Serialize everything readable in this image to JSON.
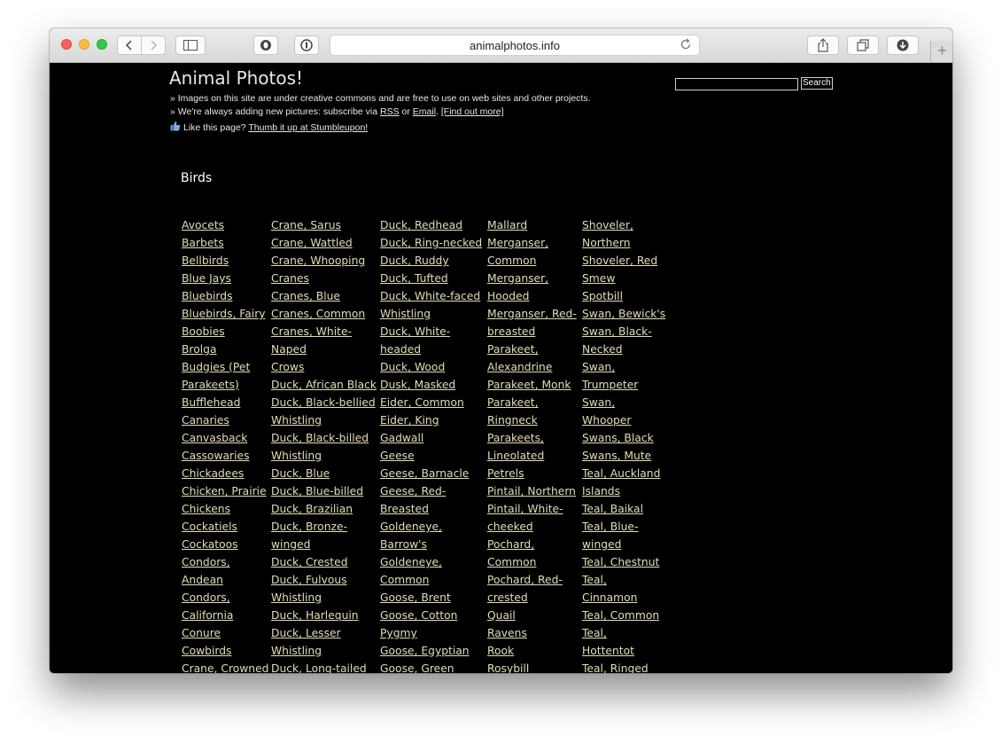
{
  "browser": {
    "url": "animalphotos.info",
    "new_tab_symbol": "+"
  },
  "site": {
    "title": "Animal Photos!",
    "line1": "» Images on this site are under creative commons and are free to use on web sites and other projects.",
    "line2_prefix": "» We're always adding new pictures: subscribe via ",
    "rss_link": "RSS",
    "line2_or": " or ",
    "email_link": "Email",
    "line2_dot": ". ",
    "find_out_more": "[Find out more]",
    "line3_text": "Like this page? ",
    "stumble_link": "Thumb it up at Stumbleupon!",
    "search_value": "",
    "search_button": "Search"
  },
  "section": {
    "heading": "Birds"
  },
  "columns": [
    [
      "Avocets",
      "Barbets",
      "Bellbirds",
      "Blue Jays",
      "Bluebirds",
      "Bluebirds, Fairy",
      "Boobies",
      "Brolga",
      "Budgies (Pet",
      "Parakeets)",
      "Bufflehead",
      "Canaries",
      "Canvasback",
      "Cassowaries",
      "Chickadees",
      "Chicken, Prairie",
      "Chickens",
      "Cockatiels",
      "Cockatoos",
      "Condors,",
      "Andean",
      "Condors,",
      "California",
      "Conure",
      "Cowbirds",
      "Crane, Crowned"
    ],
    [
      "Crane, Sarus",
      "Crane, Wattled",
      "Crane, Whooping",
      "Cranes",
      "Cranes, Blue",
      "Cranes, Common",
      "Cranes, White-",
      "Naped",
      "Crows",
      "Duck, African Black",
      "Duck, Black-bellied",
      "Whistling",
      "Duck, Black-billed",
      "Whistling",
      "Duck, Blue",
      "Duck, Blue-billed",
      "Duck, Brazilian",
      "Duck, Bronze-",
      "winged",
      "Duck, Crested",
      "Duck, Fulvous",
      "Whistling",
      "Duck, Harlequin",
      "Duck, Lesser",
      "Whistling",
      "Duck, Long-tailed"
    ],
    [
      "Duck, Redhead",
      "Duck, Ring-necked",
      "Duck, Ruddy",
      "Duck, Tufted",
      "Duck, White-faced",
      "Whistling",
      "Duck, White-",
      "headed",
      "Duck, Wood",
      "Dusk, Masked",
      "Eider, Common",
      "Eider, King",
      "Gadwall",
      "Geese",
      "Geese, Barnacle",
      "Geese, Red-",
      "Breasted",
      "Goldeneye,",
      "Barrow's",
      "Goldeneye,",
      "Common",
      "Goose, Brent",
      "Goose, Cotton",
      "Pygmy",
      "Goose, Egyptian",
      "Goose, Green"
    ],
    [
      "Mallard",
      "Merganser,",
      "Common",
      "Merganser,",
      "Hooded",
      "Merganser, Red-",
      "breasted",
      "Parakeet,",
      "Alexandrine",
      "Parakeet, Monk",
      "Parakeet,",
      "Ringneck",
      "Parakeets,",
      "Lineolated",
      "Petrels",
      "Pintail, Northern",
      "Pintail, White-",
      "cheeked",
      "Pochard,",
      "Common",
      "Pochard, Red-",
      "crested",
      "Quail",
      "Ravens",
      "Rook",
      "Rosybill"
    ],
    [
      "Shoveler,",
      "Northern",
      "Shoveler, Red",
      "Smew",
      "Spotbill",
      "Swan, Bewick's",
      "Swan, Black-",
      "Necked",
      "Swan,",
      "Trumpeter",
      "Swan,",
      "Whooper",
      "Swans, Black",
      "Swans, Mute",
      "Teal, Auckland",
      "Islands",
      "Teal, Baikal",
      "Teal, Blue-",
      "winged",
      "Teal, Chestnut",
      "Teal,",
      "Cinnamon",
      "Teal, Common",
      "Teal,",
      "Hottentot",
      "Teal, Ringed"
    ]
  ]
}
